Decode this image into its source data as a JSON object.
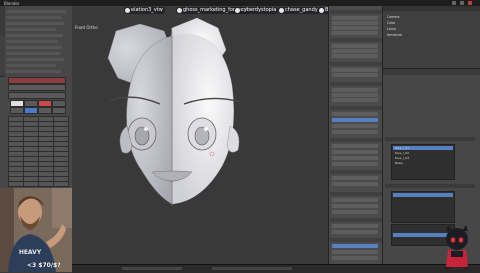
{
  "window": {
    "title": "Blender"
  },
  "overlay": {
    "items": [
      {
        "label": "elation3_vtw",
        "icon": "user-icon"
      },
      {
        "label": "ghoss_marketing_for_jack",
        "icon": "user-icon"
      },
      {
        "label": "cyberdystopia",
        "icon": "user-icon"
      },
      {
        "label": "chase_gandy",
        "icon": "user-icon"
      },
      {
        "label": "BlueVirtual",
        "icon": "user-icon"
      }
    ]
  },
  "viewport": {
    "label": "Front Ortho"
  },
  "outliner": {
    "rows": [
      "Camera",
      "Cube",
      "Lamp",
      "Armature"
    ]
  },
  "properties": {
    "list_items": [
      "face_l_01",
      "face_l_02",
      "face_l_03",
      "Basis"
    ]
  },
  "stream": {
    "donation_text": "<3 $70/$?"
  },
  "colors": {
    "accent": "#5680c2",
    "viewport_bg": "#393939",
    "panel_bg": "#474747"
  }
}
